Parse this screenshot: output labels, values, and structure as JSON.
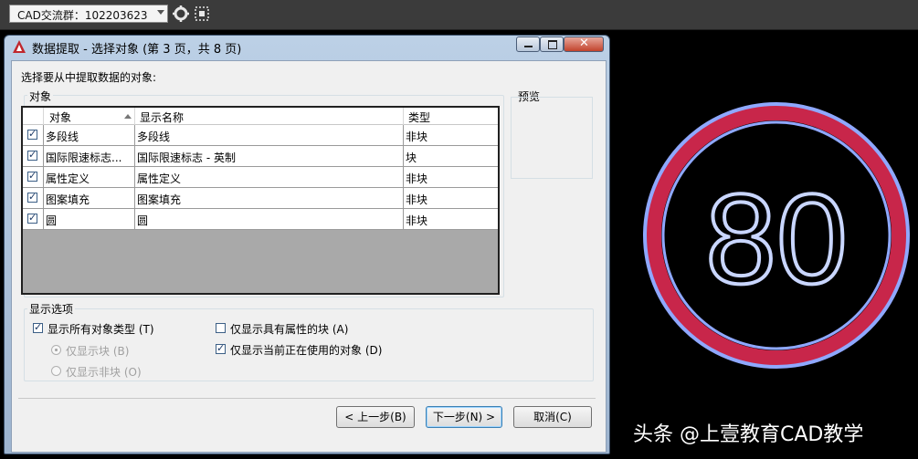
{
  "toolbar": {
    "combo_value": "CAD交流群：102203623",
    "icons": [
      "gear-icon",
      "select-frame-icon"
    ]
  },
  "dialog": {
    "title": "数据提取 - 选择对象 (第 3 页，共 8 页)",
    "instruction": "选择要从中提取数据的对象:",
    "objects_group_label": "对象",
    "preview_label": "预览",
    "columns": [
      "对象",
      "显示名称",
      "类型"
    ],
    "rows": [
      {
        "checked": true,
        "object": "多段线",
        "display": "多段线",
        "type": "非块"
      },
      {
        "checked": true,
        "object": "国际限速标志...",
        "display": "国际限速标志 - 英制",
        "type": "块"
      },
      {
        "checked": true,
        "object": "属性定义",
        "display": "属性定义",
        "type": "非块"
      },
      {
        "checked": true,
        "object": "图案填充",
        "display": "图案填充",
        "type": "非块"
      },
      {
        "checked": true,
        "object": "圆",
        "display": "圆",
        "type": "非块"
      }
    ],
    "display_options_label": "显示选项",
    "options": {
      "show_all_types": {
        "label": "显示所有对象类型 (T)",
        "checked": true
      },
      "blocks_only": {
        "label": "仅显示块 (B)",
        "selected": true,
        "enabled": false
      },
      "non_blocks_only": {
        "label": "仅显示非块 (O)",
        "selected": false,
        "enabled": false
      },
      "attr_blocks_only": {
        "label": "仅显示具有属性的块 (A)",
        "checked": false
      },
      "in_use_only": {
        "label": "仅显示当前正在使用的对象 (D)",
        "checked": true
      }
    },
    "buttons": {
      "back": "< 上一步(B)",
      "next": "下一步(N) >",
      "cancel": "取消(C)"
    }
  },
  "canvas": {
    "sign_number": "80",
    "sign_ring_color": "#c8264a",
    "sign_outline_color": "#8fa8ff"
  },
  "watermark": "头条 @上壹教育CAD教学"
}
